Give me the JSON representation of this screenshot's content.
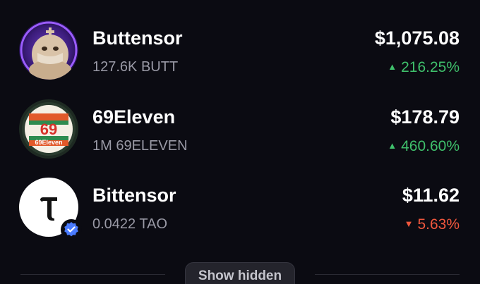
{
  "tokens": [
    {
      "name": "Buttensor",
      "balance": "127.6K BUTT",
      "value": "$1,075.08",
      "change": "216.25%",
      "direction": "up",
      "icon": "buttensor-logo-icon"
    },
    {
      "name": "69Eleven",
      "balance": "1M 69ELEVEN",
      "value": "$178.79",
      "change": "460.60%",
      "direction": "up",
      "icon": "69eleven-logo-icon",
      "logo_text": "69Eleven"
    },
    {
      "name": "Bittensor",
      "balance": "0.0422 TAO",
      "value": "$11.62",
      "change": "5.63%",
      "direction": "down",
      "icon": "tao-logo-icon",
      "badge_icon": "verified-badge-icon"
    }
  ],
  "arrows": {
    "up": "▲",
    "down": "▼"
  },
  "footer": {
    "show_hidden_label": "Show hidden"
  },
  "colors": {
    "background": "#0b0b12",
    "positive": "#3fbf6b",
    "negative": "#f0573d",
    "verified": "#4a7bff"
  }
}
